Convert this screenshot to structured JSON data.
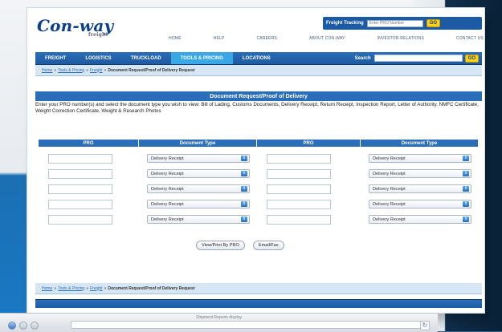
{
  "brand": {
    "logo_text": "Con-way",
    "logo_subtext": "freight"
  },
  "tracking": {
    "label": "Freight Tracking",
    "placeholder": "Enter PRO Number",
    "go_label": "GO"
  },
  "util_nav": [
    "HOME",
    "HELP",
    "CAREERS",
    "ABOUT CON-WAY",
    "INVESTOR RELATIONS",
    "CONTACT US"
  ],
  "main_nav": {
    "items": [
      "FREIGHT",
      "LOGISTICS",
      "TRUCKLOAD",
      "TOOLS & PRICING",
      "LOCATIONS"
    ],
    "active_index": 3,
    "search_label": "Search",
    "go_label": "GO"
  },
  "breadcrumb": {
    "links": [
      "Home",
      "Tools & Pricing",
      "Freight"
    ],
    "current": "Document Request/Proof of Delivery Request"
  },
  "page": {
    "title": "Document Request/Proof of Delivery",
    "intro": "Enter your PRO number(s) and select the document type you wish to view: Bill of Lading, Customs Documents, Delivery Receipt, Return Receipt, Inspection Report, Letter of Authority, NMFC Certificate, Weight Correction Certificate, Weight & Research Photos"
  },
  "form": {
    "headers": [
      "PRO",
      "Document Type",
      "PRO",
      "Document Type"
    ],
    "rows": [
      {
        "pro_left": "",
        "doc_left": "Delivery Receipt",
        "pro_right": "",
        "doc_right": "Delivery Receipt"
      },
      {
        "pro_left": "",
        "doc_left": "Delivery Receipt",
        "pro_right": "",
        "doc_right": "Delivery Receipt"
      },
      {
        "pro_left": "",
        "doc_left": "Delivery Receipt",
        "pro_right": "",
        "doc_right": "Delivery Receipt"
      },
      {
        "pro_left": "",
        "doc_left": "Delivery Receipt",
        "pro_right": "",
        "doc_right": "Delivery Receipt"
      },
      {
        "pro_left": "",
        "doc_left": "Delivery Receipt",
        "pro_right": "",
        "doc_right": "Delivery Receipt"
      }
    ],
    "view_print_label": "View/Print By PRO",
    "email_fax_label": "Email/Fax"
  },
  "subwindow": {
    "title": "Shipment Reports display"
  },
  "colors": {
    "brand_blue": "#2a6db8",
    "active_tab": "#3aa7e6",
    "go_yellow": "#ffd21a"
  }
}
